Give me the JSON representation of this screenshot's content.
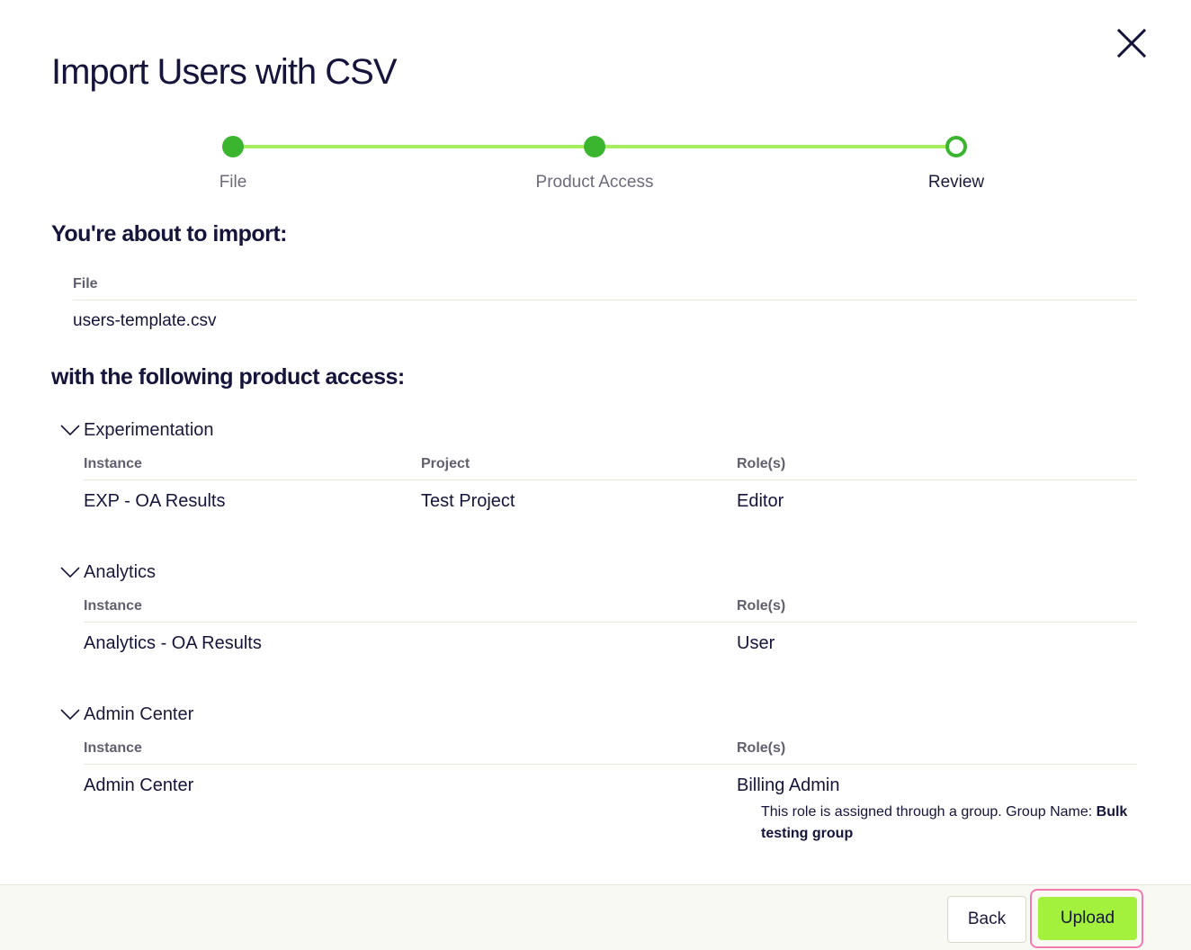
{
  "dialog": {
    "title": "Import Users with CSV",
    "close_icon": "close-icon"
  },
  "stepper": {
    "steps": [
      {
        "label": "File",
        "state": "complete"
      },
      {
        "label": "Product Access",
        "state": "complete"
      },
      {
        "label": "Review",
        "state": "current"
      }
    ],
    "colors": {
      "line": "#a5ef5f",
      "dot": "#3bb530"
    }
  },
  "summary": {
    "heading": "You're about to import:",
    "file_header": "File",
    "file_name": "users-template.csv"
  },
  "access": {
    "heading": "with the following product access:",
    "sections": [
      {
        "title": "Experimentation",
        "icon": "chevron-down-icon",
        "headers": {
          "instance": "Instance",
          "project": "Project",
          "roles": "Role(s)"
        },
        "row": {
          "instance": "EXP - OA Results",
          "project": "Test Project",
          "roles": "Editor"
        }
      },
      {
        "title": "Analytics",
        "icon": "chevron-down-icon",
        "headers": {
          "instance": "Instance",
          "roles": "Role(s)"
        },
        "row": {
          "instance": "Analytics - OA Results",
          "roles": "User"
        }
      },
      {
        "title": "Admin Center",
        "icon": "chevron-down-icon",
        "headers": {
          "instance": "Instance",
          "roles": "Role(s)"
        },
        "row": {
          "instance": "Admin Center",
          "roles": "Billing Admin"
        },
        "note_prefix": "This role is assigned through a group. Group Name: ",
        "note_group": "Bulk testing group"
      }
    ]
  },
  "footer": {
    "back_label": "Back",
    "upload_label": "Upload",
    "upload_color": "#a3f13c",
    "focus_ring_color": "#f07ab1"
  }
}
